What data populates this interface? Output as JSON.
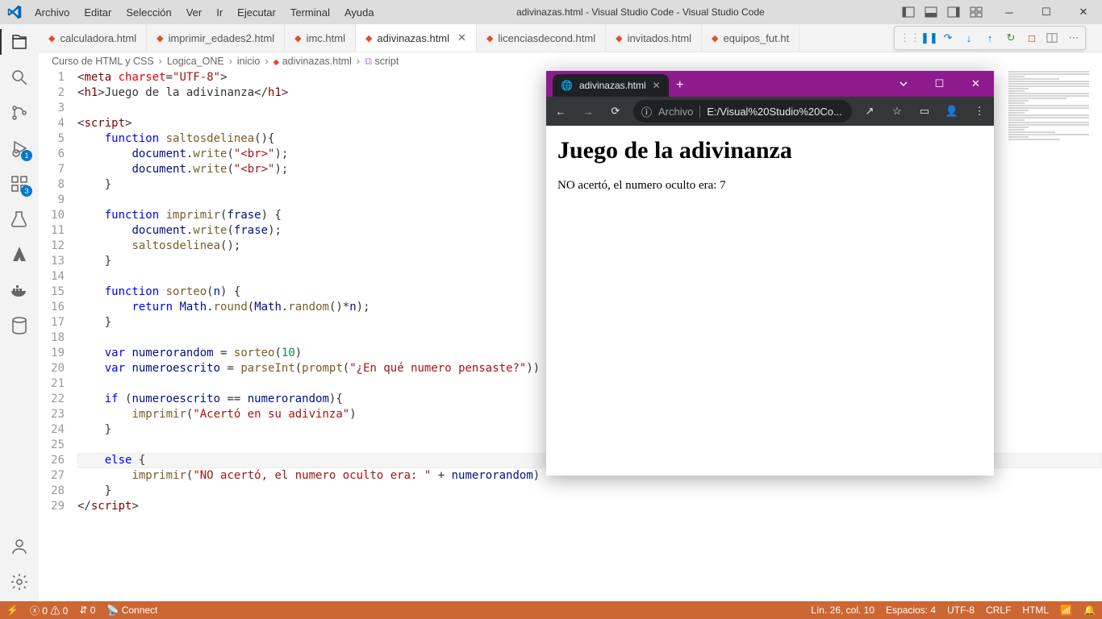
{
  "window": {
    "title": "adivinazas.html - Visual Studio Code - Visual Studio Code"
  },
  "menu": [
    "Archivo",
    "Editar",
    "Selección",
    "Ver",
    "Ir",
    "Ejecutar",
    "Terminal",
    "Ayuda"
  ],
  "activity_badges": {
    "debug": "1",
    "extensions": "3"
  },
  "tabs": [
    {
      "label": "calculadora.html",
      "active": false
    },
    {
      "label": "imprimir_edades2.html",
      "active": false
    },
    {
      "label": "imc.html",
      "active": false
    },
    {
      "label": "adivinazas.html",
      "active": true
    },
    {
      "label": "licenciasdecond.html",
      "active": false
    },
    {
      "label": "invitados.html",
      "active": false
    },
    {
      "label": "equipos_fut.ht",
      "active": false
    }
  ],
  "breadcrumb": [
    "Curso de HTML y CSS",
    "Logica_ONE",
    "inicio",
    "adivinazas.html",
    "script"
  ],
  "code_lines": [
    {
      "n": 1,
      "html": "&lt;<span class='tok-tag'>meta</span> <span class='tok-attr'>charset</span>=<span class='tok-str'>\"UTF-8\"</span>&gt;"
    },
    {
      "n": 2,
      "html": "&lt;<span class='tok-tag'>h1</span>&gt;Juego de la adivinanza&lt;/<span class='tok-tag'>h1</span>&gt;"
    },
    {
      "n": 3,
      "html": ""
    },
    {
      "n": 4,
      "html": "&lt;<span class='tok-tag'>script</span>&gt;"
    },
    {
      "n": 5,
      "html": "    <span class='tok-kw'>function</span> <span class='tok-fn'>saltosdelinea</span>(){"
    },
    {
      "n": 6,
      "html": "        <span class='tok-obj'>document</span>.<span class='tok-fn'>write</span>(<span class='tok-str'>\"&lt;br&gt;\"</span>);"
    },
    {
      "n": 7,
      "html": "        <span class='tok-obj'>document</span>.<span class='tok-fn'>write</span>(<span class='tok-str'>\"&lt;br&gt;\"</span>);"
    },
    {
      "n": 8,
      "html": "    }"
    },
    {
      "n": 9,
      "html": ""
    },
    {
      "n": 10,
      "html": "    <span class='tok-kw'>function</span> <span class='tok-fn'>imprimir</span>(<span class='tok-var'>frase</span>) {"
    },
    {
      "n": 11,
      "html": "        <span class='tok-obj'>document</span>.<span class='tok-fn'>write</span>(<span class='tok-var'>frase</span>);"
    },
    {
      "n": 12,
      "html": "        <span class='tok-fn'>saltosdelinea</span>();"
    },
    {
      "n": 13,
      "html": "    }"
    },
    {
      "n": 14,
      "html": ""
    },
    {
      "n": 15,
      "html": "    <span class='tok-kw'>function</span> <span class='tok-fn'>sorteo</span>(<span class='tok-var'>n</span>) {"
    },
    {
      "n": 16,
      "html": "        <span class='tok-kw'>return</span> <span class='tok-obj'>Math</span>.<span class='tok-fn'>round</span>(<span class='tok-obj'>Math</span>.<span class='tok-fn'>random</span>()*<span class='tok-var'>n</span>);"
    },
    {
      "n": 17,
      "html": "    }"
    },
    {
      "n": 18,
      "html": ""
    },
    {
      "n": 19,
      "html": "    <span class='tok-kw'>var</span> <span class='tok-var'>numerorandom</span> = <span class='tok-fn'>sorteo</span>(<span class='tok-num'>10</span>)"
    },
    {
      "n": 20,
      "html": "    <span class='tok-kw'>var</span> <span class='tok-var'>numeroescrito</span> = <span class='tok-fn'>parseInt</span>(<span class='tok-fn'>prompt</span>(<span class='tok-str'>\"¿En qué numero pensaste?\"</span>))"
    },
    {
      "n": 21,
      "html": ""
    },
    {
      "n": 22,
      "html": "    <span class='tok-kw'>if</span> (<span class='tok-var'>numeroescrito</span> == <span class='tok-var'>numerorandom</span>){"
    },
    {
      "n": 23,
      "html": "        <span class='tok-fn'>imprimir</span>(<span class='tok-str'>\"Acertó en su adivinza\"</span>)"
    },
    {
      "n": 24,
      "html": "    }"
    },
    {
      "n": 25,
      "html": ""
    },
    {
      "n": 26,
      "html": "    <span class='tok-kw'>else</span> {"
    },
    {
      "n": 27,
      "html": "        <span class='tok-fn'>imprimir</span>(<span class='tok-str'>\"NO acertó, el numero oculto era: \"</span> + <span class='tok-var'>numerorandom</span>)"
    },
    {
      "n": 28,
      "html": "    }"
    },
    {
      "n": 29,
      "html": "&lt;/<span class='tok-tag'>script</span>&gt;"
    }
  ],
  "current_line": 26,
  "status": {
    "errors": "0",
    "warnings": "0",
    "connect": "Connect",
    "pos": "Lín. 26, col. 10",
    "spaces": "Espacios: 4",
    "enc": "UTF-8",
    "eol": "CRLF",
    "lang": "HTML"
  },
  "browser": {
    "tab_title": "adivinazas.html",
    "url_scheme_label": "Archivo",
    "url": "E:/Visual%20Studio%20Co...",
    "page_h1": "Juego de la adivinanza",
    "page_text": "NO acertó, el numero oculto era: 7"
  }
}
